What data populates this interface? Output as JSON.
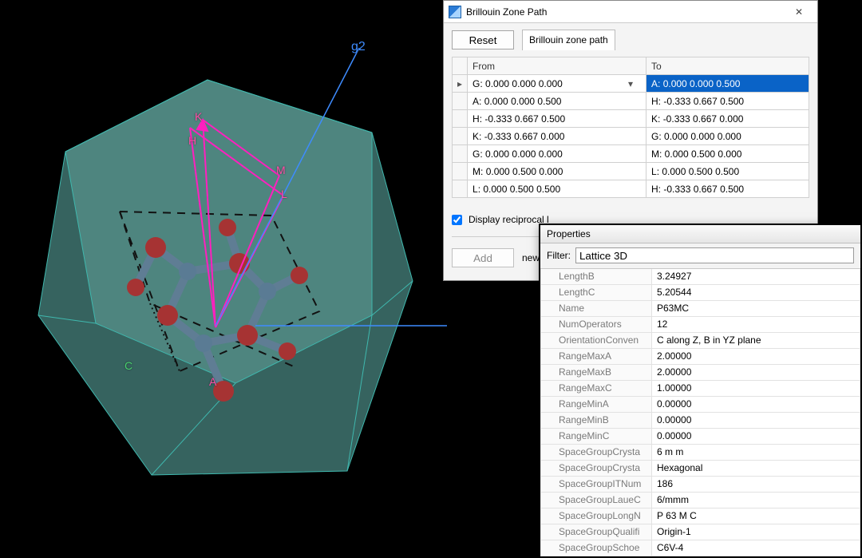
{
  "viewport": {
    "g2_label": "g2",
    "labels": {
      "K": "K",
      "H": "H",
      "M": "M",
      "L": "L",
      "A": "A",
      "C": "C"
    }
  },
  "bz_dialog": {
    "title": "Brillouin Zone Path",
    "reset_label": "Reset",
    "tab_label": "Brillouin zone path",
    "columns": {
      "from": "From",
      "to": "To"
    },
    "rows": [
      {
        "from": "G:  0.000  0.000  0.000",
        "to": "A:  0.000  0.000  0.500",
        "selected_to": true,
        "current": true
      },
      {
        "from": "A:  0.000  0.000  0.500",
        "to": "H:  -0.333  0.667  0.500"
      },
      {
        "from": "H:  -0.333  0.667  0.500",
        "to": "K:  -0.333  0.667  0.000"
      },
      {
        "from": "K:  -0.333  0.667  0.000",
        "to": "G:  0.000  0.000  0.000"
      },
      {
        "from": "G:  0.000  0.000  0.000",
        "to": "M:  0.000  0.500  0.000"
      },
      {
        "from": "M:  0.000  0.500  0.000",
        "to": "L:  0.000  0.500  0.500"
      },
      {
        "from": "L:  0.000  0.500  0.500",
        "to": "H:  -0.333  0.667  0.500"
      }
    ],
    "display_reciprocal_label": "Display reciprocal l",
    "add_label": "Add",
    "newpoint_label": "new p"
  },
  "properties": {
    "title": "Properties",
    "filter_label": "Filter:",
    "filter_value": "Lattice 3D",
    "rows": [
      {
        "k": "LengthB",
        "v": "3.24927"
      },
      {
        "k": "LengthC",
        "v": "5.20544"
      },
      {
        "k": "Name",
        "v": "P63MC"
      },
      {
        "k": "NumOperators",
        "v": "12"
      },
      {
        "k": "OrientationConven",
        "v": "C along Z, B in YZ plane"
      },
      {
        "k": "RangeMaxA",
        "v": "2.00000"
      },
      {
        "k": "RangeMaxB",
        "v": "2.00000"
      },
      {
        "k": "RangeMaxC",
        "v": "1.00000"
      },
      {
        "k": "RangeMinA",
        "v": "0.00000"
      },
      {
        "k": "RangeMinB",
        "v": "0.00000"
      },
      {
        "k": "RangeMinC",
        "v": "0.00000"
      },
      {
        "k": "SpaceGroupCrysta",
        "v": "6 m m"
      },
      {
        "k": "SpaceGroupCrysta",
        "v": "Hexagonal"
      },
      {
        "k": "SpaceGroupITNum",
        "v": "186"
      },
      {
        "k": "SpaceGroupLaueC",
        "v": "6/mmm"
      },
      {
        "k": "SpaceGroupLongN",
        "v": "P 63 M C"
      },
      {
        "k": "SpaceGroupQualifi",
        "v": "Origin-1"
      },
      {
        "k": "SpaceGroupSchoe",
        "v": "C6V-4"
      }
    ]
  }
}
